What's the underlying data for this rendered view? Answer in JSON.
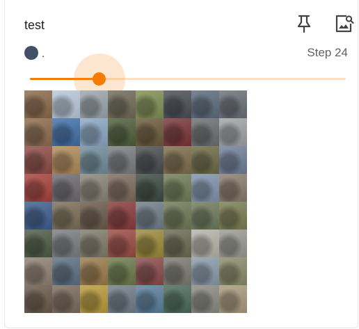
{
  "card": {
    "title": "test",
    "run_name": ".",
    "run_color": "#425066",
    "step_label": "Step 24",
    "slider_value_fraction": 0.22,
    "accent_color": "#f57c00"
  },
  "icons": {
    "pin": "pin-icon",
    "image_search": "image-search-icon"
  },
  "image_grid": {
    "rows": 8,
    "columns": 8,
    "tile_colors": [
      [
        "#8a6a4a",
        "#b7c8d9",
        "#9aa4ad",
        "#6f6a58",
        "#7f8f52",
        "#4a4f55",
        "#5c6b7d",
        "#6a7078"
      ],
      [
        "#8c6b4d",
        "#3f6fa8",
        "#8aa6c2",
        "#4d5e3a",
        "#6b5a3a",
        "#7a3438",
        "#6b6e70",
        "#9fa3a6"
      ],
      [
        "#8f4b46",
        "#b08a5a",
        "#6f8c9c",
        "#7a7c80",
        "#4a4c50",
        "#7d6c4a",
        "#6d6a44",
        "#6f7f99"
      ],
      [
        "#a8413c",
        "#6c6a70",
        "#8a8476",
        "#7d6a5e",
        "#3c4a42",
        "#6f7c58",
        "#7f93ab",
        "#8a7a6c"
      ],
      [
        "#3d5d8f",
        "#7a6e56",
        "#6a5a4a",
        "#8a3a3a",
        "#6f7c88",
        "#6f7856",
        "#6e7a5c",
        "#7a7d52"
      ],
      [
        "#4d5a44",
        "#7a7c80",
        "#7f7a6a",
        "#9a4a44",
        "#9b8a38",
        "#6a6a52",
        "#b4b4a8",
        "#9a9a94"
      ],
      [
        "#8f7f72",
        "#5a6f82",
        "#9a7a4a",
        "#6a7a4a",
        "#8a4a4a",
        "#7a7a70",
        "#8a9aaa",
        "#8a8a6a"
      ],
      [
        "#6a5a4a",
        "#7a6a5c",
        "#b89a3a",
        "#6f7c88",
        "#5a7f9c",
        "#4a6a5a",
        "#8a8a80",
        "#a89a7c"
      ]
    ]
  }
}
